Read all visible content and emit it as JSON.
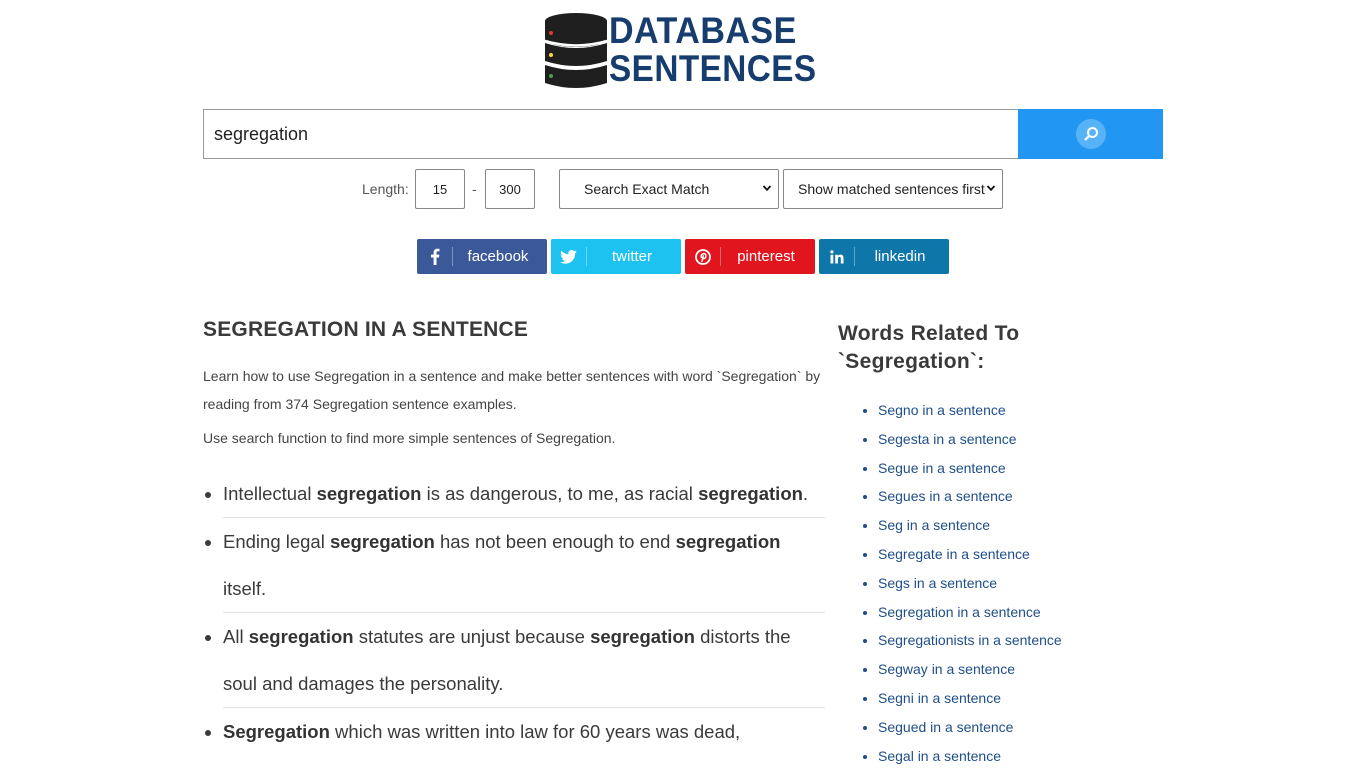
{
  "logo": {
    "line1": "DATABASE",
    "line2": "SENTENCES"
  },
  "search": {
    "value": "segregation",
    "button_icon": "search-icon"
  },
  "filters": {
    "length_label": "Length:",
    "min_length": "15",
    "separator": "-",
    "max_length": "300",
    "match_mode": "Search Exact Match",
    "sort_mode": "Show matched sentences first"
  },
  "social": [
    {
      "label": "facebook",
      "icon": "facebook-icon",
      "color": "#3b5998"
    },
    {
      "label": "twitter",
      "icon": "twitter-icon",
      "color": "#1dc2f0"
    },
    {
      "label": "pinterest",
      "icon": "pinterest-icon",
      "color": "#e0151e"
    },
    {
      "label": "linkedin",
      "icon": "linkedin-icon",
      "color": "#0e76a8"
    }
  ],
  "main": {
    "title": "SEGREGATION IN A SENTENCE",
    "intro": "Learn how to use Segregation in a sentence and make better sentences with word `Segregation` by reading from 374 Segregation sentence examples.",
    "intro2": "Use search function to find more simple sentences of Segregation.",
    "sentences": [
      [
        {
          "t": "Intellectual "
        },
        {
          "b": "segregation"
        },
        {
          "t": " is as dangerous, to me, as racial "
        },
        {
          "b": "segregation"
        },
        {
          "t": "."
        }
      ],
      [
        {
          "t": "Ending legal "
        },
        {
          "b": "segregation"
        },
        {
          "t": " has not been enough to end "
        },
        {
          "b": "segregation"
        },
        {
          "t": " itself."
        }
      ],
      [
        {
          "t": "All "
        },
        {
          "b": "segregation"
        },
        {
          "t": " statutes are unjust because "
        },
        {
          "b": "segregation"
        },
        {
          "t": " distorts the soul and damages the personality."
        }
      ],
      [
        {
          "b": "Segregation"
        },
        {
          "t": " which was written into law for 60 years was dead,"
        }
      ]
    ]
  },
  "sidebar": {
    "title": "Words Related To `Segregation`:",
    "links": [
      "Segno in a sentence",
      "Segesta in a sentence",
      "Segue in a sentence",
      "Segues in a sentence",
      "Seg in a sentence",
      "Segregate in a sentence",
      "Segs in a sentence",
      "Segregation in a sentence",
      "Segregationists in a sentence",
      "Segway in a sentence",
      "Segni in a sentence",
      "Segued in a sentence",
      "Segal in a sentence"
    ]
  },
  "colors": {
    "accent": "#2196f3",
    "logo": "#163d6e",
    "link": "#1f4e8a"
  }
}
